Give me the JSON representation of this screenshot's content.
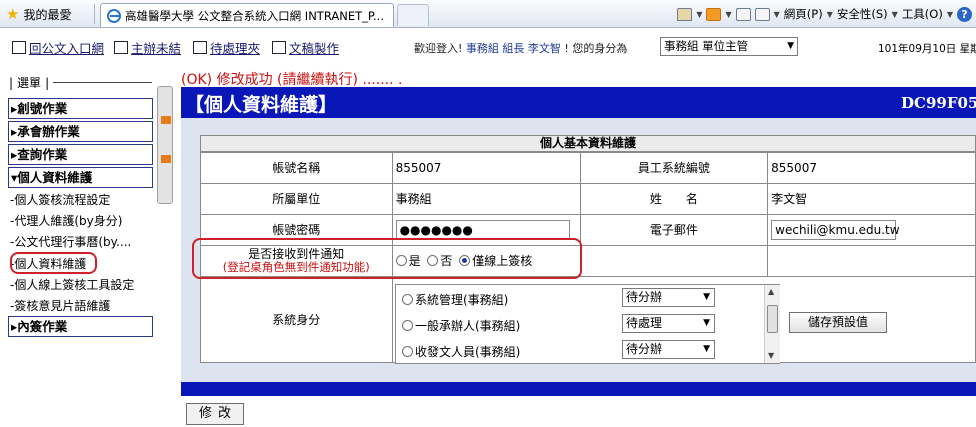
{
  "browser": {
    "favorites": "我的最愛",
    "tab_title": "高雄醫學大學 公文整合系統入口網 INTRANET_P...",
    "menu_page": "網頁(P)",
    "menu_safety": "安全性(S)",
    "menu_tools": "工具(O)",
    "help": "?"
  },
  "topnav": {
    "links": [
      "回公文入口網",
      "主辦未結",
      "待處理夾",
      "文稿製作"
    ],
    "welcome_prefix": "歡迎登入!",
    "welcome_unit": "事務組",
    "welcome_title": "組長",
    "welcome_name": "李文智",
    "role_label": "!  您的身分為",
    "role_value": "事務組 單位主管",
    "date": "101年09月10日 星期"
  },
  "menu": {
    "header": "選單",
    "top_items": [
      "創號作業",
      "承會辦作業",
      "查詢作業",
      "個人資料維護"
    ],
    "sub_items": [
      "-個人簽核流程設定",
      "-代理人維護(by身分)",
      "-公文代理行事曆(by....",
      "-個人資料維護",
      "-個人線上簽核工具設定",
      "-簽核意見片語維護"
    ],
    "bottom_item": "內簽作業"
  },
  "status_message": "(OK) 修改成功 (請繼續執行) ....... .",
  "page_title": "【個人資料維護】",
  "page_code": "DC99F05",
  "form": {
    "caption": "個人基本資料維護",
    "account_name_label": "帳號名稱",
    "account_name_value": "855007",
    "employee_id_label": "員工系統編號",
    "employee_id_value": "855007",
    "unit_label": "所屬單位",
    "unit_value": "事務組",
    "name_label": "姓　　名",
    "name_value": "李文智",
    "password_label": "帳號密碼",
    "password_value": "●●●●●●●",
    "email_label": "電子郵件",
    "email_value": "wechili@kmu.edu.tw",
    "notify_label": "是否接收到件通知",
    "notify_note": "(登記桌角色無到件通知功能)",
    "notify_options": [
      "是",
      "否",
      "僅線上簽核"
    ],
    "notify_selected": "僅線上簽核",
    "system_identity_label": "系統身分",
    "system_roles": [
      {
        "name": "系統管理(事務組)",
        "status": "待分辦"
      },
      {
        "name": "一般承辦人(事務組)",
        "status": "待處理"
      },
      {
        "name": "收發文人員(事務組)",
        "status": "待分辦"
      }
    ],
    "save_default_label": "儲存預設值"
  },
  "modify_button": "修改"
}
